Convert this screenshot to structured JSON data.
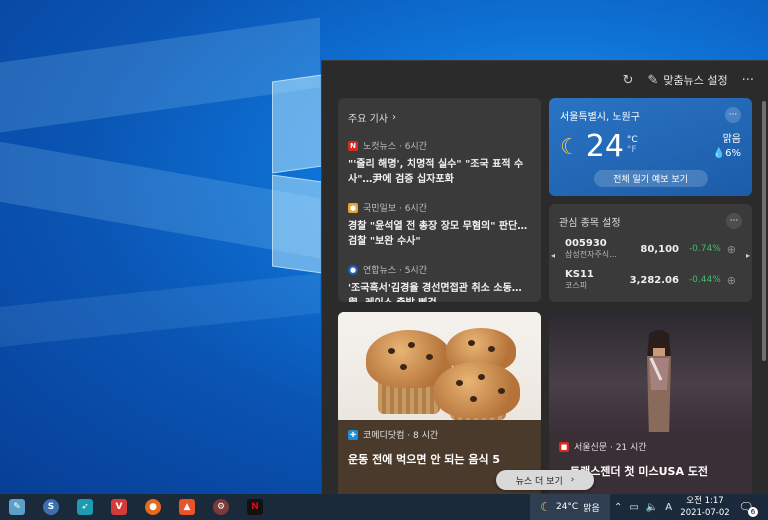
{
  "panel": {
    "header": {
      "personalize_label": "맞춤뉴스 설정",
      "refresh_icon": "refresh-icon",
      "more_icon": "more-icon"
    }
  },
  "top_stories": {
    "title": "주요 기사",
    "items": [
      {
        "source": "노컷뉴스 · 6시간",
        "headline": "\"'줄리 해명', 치명적 실수\" \"조국 표적 수사\"…尹에 검증 십자포화",
        "logo_color": "#d52b1e",
        "logo_glyph": "N"
      },
      {
        "source": "국민일보 · 6시간",
        "headline": "경찰 \"윤석열 전 총장 장모 무혐의\" 판단… 검찰 \"보완 수사\"",
        "logo_color": "#e8a33b",
        "logo_glyph": "국"
      },
      {
        "source": "연합뉴스 · 5시간",
        "headline": "'조국흑서'김경율 경선면접관 취소 소동…與, 레이스 출발 삐걱",
        "logo_color": "#1f5fbf",
        "logo_glyph": "연"
      }
    ]
  },
  "weather": {
    "location": "서울특별시, 노원구",
    "temperature": "24",
    "unit_c": "°C",
    "unit_f": "°F",
    "condition": "맑음",
    "precip": "6%",
    "forecast_button": "전체 일기 예보 보기"
  },
  "stocks": {
    "title": "관심 종목 설정",
    "items": [
      {
        "symbol": "005930",
        "name": "삼성전자주식...",
        "price": "80,100",
        "change": "-0.74%"
      },
      {
        "symbol": "KS11",
        "name": "코스피",
        "price": "3,282.06",
        "change": "-0.44%"
      }
    ]
  },
  "stories": [
    {
      "source": "코메디닷컴 · 8 시간",
      "title": "운동 전에 먹으면 안 되는 음식 5",
      "logo_color": "#1e8fd6"
    },
    {
      "source": "서울신문 · 21 시간",
      "title": "…트랜스젠더 첫 미스USA 도전",
      "logo_color": "#d52b1e"
    }
  ],
  "news_more_button": "뉴스 더 보기",
  "taskbar": {
    "weather_temp": "24°C",
    "weather_cond": "맑음",
    "ime_label": "A",
    "clock_time": "오전 1:17",
    "clock_date": "2021-07-02",
    "notification_count": "6",
    "apps": [
      {
        "name": "notepad-app-icon",
        "color": "#5aa0c8",
        "glyph": "✎"
      },
      {
        "name": "browser-s-app-icon",
        "color": "#3b6fb0",
        "glyph": "S"
      },
      {
        "name": "bird-app-icon",
        "color": "#1d9bb0",
        "glyph": "➶"
      },
      {
        "name": "vivaldi-app-icon",
        "color": "#d63b3b",
        "glyph": "V"
      },
      {
        "name": "firefox-app-icon",
        "color": "#e66a1e",
        "glyph": "🦊"
      },
      {
        "name": "brave-app-icon",
        "color": "#e8532a",
        "glyph": "▲"
      },
      {
        "name": "settings-app-icon",
        "color": "#7a3b3b",
        "glyph": "⚙"
      },
      {
        "name": "netflix-app-icon",
        "color": "#111111",
        "glyph": "N"
      }
    ]
  }
}
